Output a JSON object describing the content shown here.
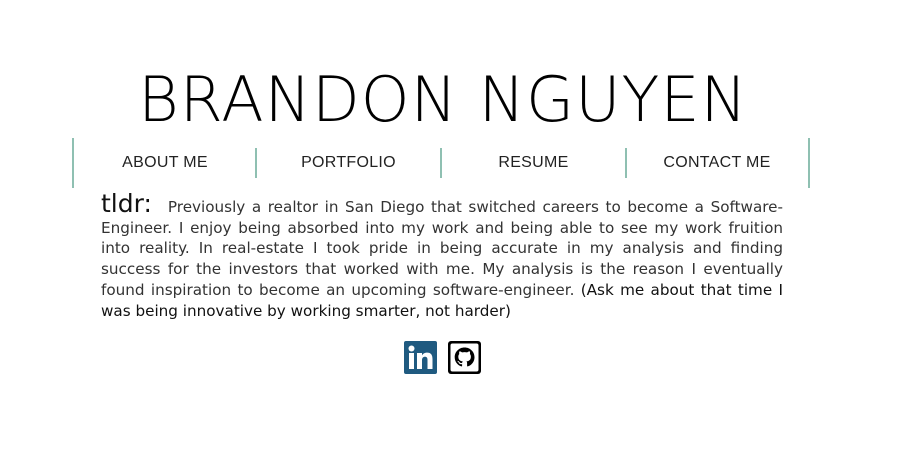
{
  "header": {
    "name": "BRANDON NGUYEN"
  },
  "nav": {
    "items": [
      {
        "label": "ABOUT ME"
      },
      {
        "label": "PORTFOLIO"
      },
      {
        "label": "RESUME"
      },
      {
        "label": "CONTACT ME"
      }
    ],
    "divider_color": "#8fc0b2"
  },
  "about": {
    "lead": "tldr:",
    "body": "Previously a realtor in San Diego that switched careers to become a Software-Engineer. I enjoy being absorbed into my work and being able to see my work fruition into reality. In real-estate I took pride in being accurate in my analysis and finding success for the investors that worked with me. My analysis is the reason I eventually found inspiration to become an upcoming software-engineer.",
    "aside": "(Ask me about that time I was being innovative by working smarter, not harder)"
  },
  "socials": {
    "items": [
      {
        "icon": "linkedin-icon",
        "color": "#1f5a80"
      },
      {
        "icon": "github-icon",
        "color": "#000000"
      }
    ]
  }
}
